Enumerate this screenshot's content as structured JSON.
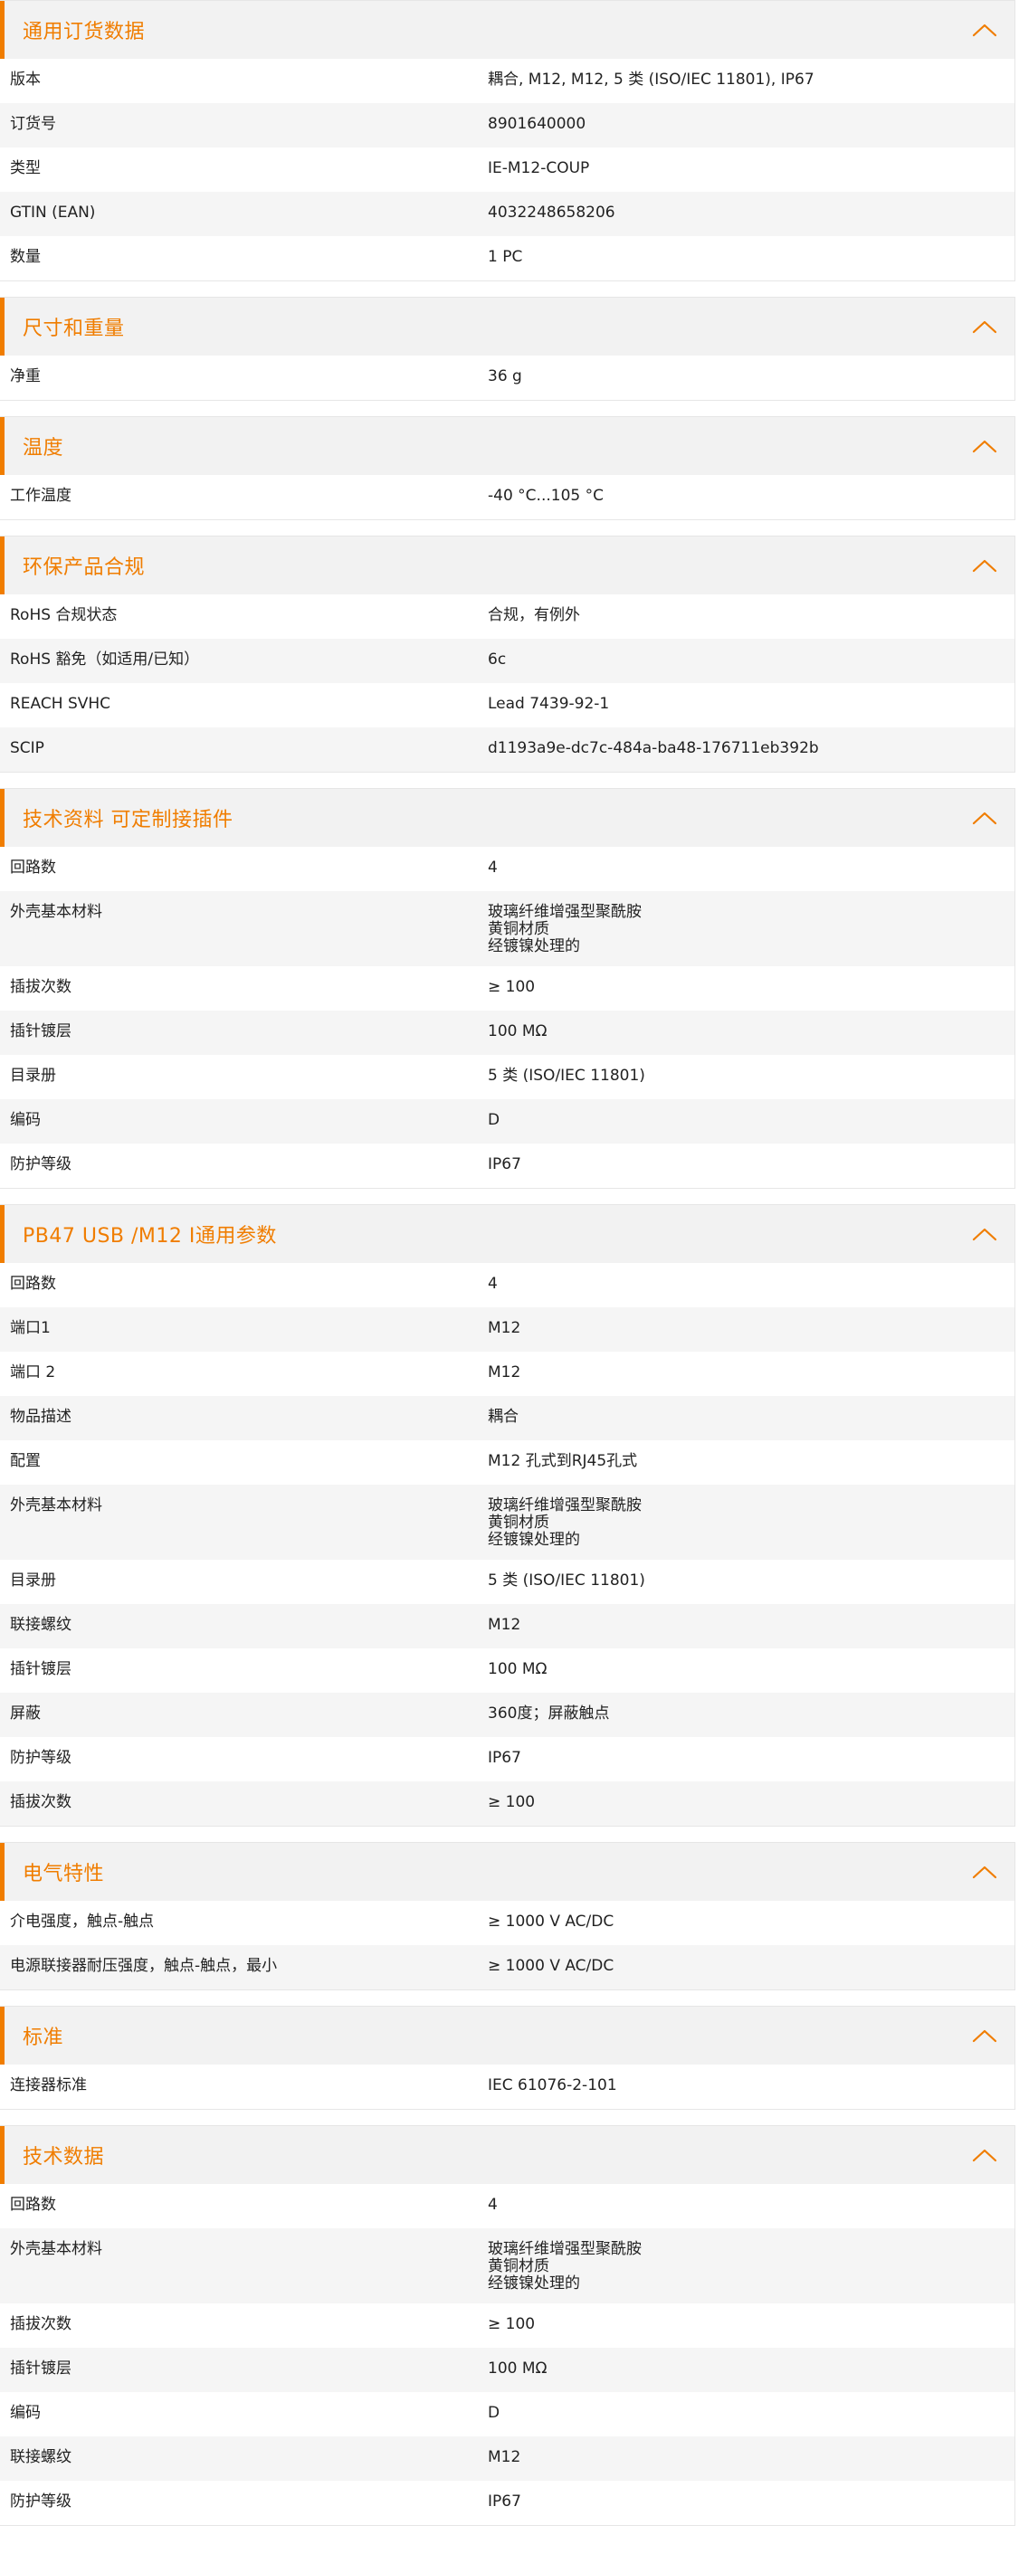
{
  "icons": {
    "collapse": "chevron-up-icon"
  },
  "colors": {
    "accent": "#f07d00",
    "header_bg": "#f2f2f2",
    "row_alt_bg": "#f5f5f5",
    "text": "#222222"
  },
  "sections": [
    {
      "title": "通用订货数据",
      "rows": [
        {
          "label": "版本",
          "value": "耦合, M12, M12, 5 类 (ISO/IEC 11801), IP67"
        },
        {
          "label": "订货号",
          "value": "8901640000"
        },
        {
          "label": "类型",
          "value": "IE-M12-COUP"
        },
        {
          "label": "GTIN (EAN)",
          "value": "4032248658206"
        },
        {
          "label": "数量",
          "value": "1  PC"
        }
      ]
    },
    {
      "title": "尺寸和重量",
      "rows": [
        {
          "label": "净重",
          "value": "36  g"
        }
      ]
    },
    {
      "title": "温度",
      "rows": [
        {
          "label": "工作温度",
          "value": "-40 °C...105 °C"
        }
      ]
    },
    {
      "title": "环保产品合规",
      "rows": [
        {
          "label": "RoHS 合规状态",
          "value": "合规，有例外"
        },
        {
          "label": "RoHS 豁免（如适用/已知）",
          "value": "6c"
        },
        {
          "label": "REACH SVHC",
          "value": "Lead 7439-92-1"
        },
        {
          "label": "SCIP",
          "value": "d1193a9e-dc7c-484a-ba48-176711eb392b"
        }
      ]
    },
    {
      "title": "技术资料 可定制接插件",
      "rows": [
        {
          "label": "回路数",
          "value": "4"
        },
        {
          "label": "外壳基本材料",
          "value": "玻璃纤维增强型聚酰胺\n黄铜材质\n经镀镍处理的"
        },
        {
          "label": "插拔次数",
          "value": "≥ 100"
        },
        {
          "label": "插针镀层",
          "value": "100 MΩ"
        },
        {
          "label": "目录册",
          "value": "5 类 (ISO/IEC 11801)"
        },
        {
          "label": "编码",
          "value": "D"
        },
        {
          "label": "防护等级",
          "value": "IP67"
        }
      ]
    },
    {
      "title": "PB47 USB /M12 I通用参数",
      "rows": [
        {
          "label": "回路数",
          "value": "4"
        },
        {
          "label": "端口1",
          "value": "M12"
        },
        {
          "label": "端口 2",
          "value": "M12"
        },
        {
          "label": "物品描述",
          "value": "耦合"
        },
        {
          "label": "配置",
          "value": "M12 孔式到RJ45孔式"
        },
        {
          "label": "外壳基本材料",
          "value": "玻璃纤维增强型聚酰胺\n黄铜材质\n经镀镍处理的"
        },
        {
          "label": "目录册",
          "value": "5 类 (ISO/IEC 11801)"
        },
        {
          "label": "联接螺纹",
          "value": "M12"
        },
        {
          "label": "插针镀层",
          "value": "100 MΩ"
        },
        {
          "label": "屏蔽",
          "value": "360度；屏蔽触点"
        },
        {
          "label": "防护等级",
          "value": "IP67"
        },
        {
          "label": "插拔次数",
          "value": "≥ 100"
        }
      ]
    },
    {
      "title": "电气特性",
      "rows": [
        {
          "label": "介电强度，触点-触点",
          "value": "≥ 1000 V AC/DC"
        },
        {
          "label": "电源联接器耐压强度，触点-触点，最小",
          "value": "≥ 1000 V AC/DC"
        }
      ]
    },
    {
      "title": "标准",
      "rows": [
        {
          "label": "连接器标准",
          "value": "IEC 61076-2-101"
        }
      ]
    },
    {
      "title": "技术数据",
      "rows": [
        {
          "label": "回路数",
          "value": "4"
        },
        {
          "label": "外壳基本材料",
          "value": "玻璃纤维增强型聚酰胺\n黄铜材质\n经镀镍处理的"
        },
        {
          "label": "插拔次数",
          "value": "≥ 100"
        },
        {
          "label": "插针镀层",
          "value": "100 MΩ"
        },
        {
          "label": "编码",
          "value": "D"
        },
        {
          "label": "联接螺纹",
          "value": "M12"
        },
        {
          "label": "防护等级",
          "value": "IP67"
        }
      ]
    }
  ]
}
